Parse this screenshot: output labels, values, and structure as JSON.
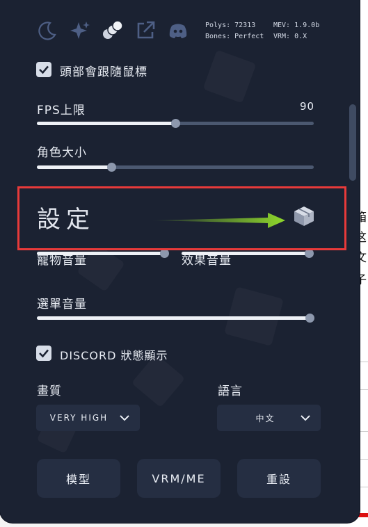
{
  "background_page": {
    "chars": [
      "箱",
      "这",
      "文",
      "子"
    ]
  },
  "toolbar": {
    "icons": [
      "moon-icon",
      "sparkles-icon",
      "coins-icon",
      "external-link-icon",
      "discord-icon"
    ]
  },
  "stats": {
    "polys": "Polys: 72313",
    "bones": "Bones: Perfect",
    "mev": "MEV: 1.9.0b",
    "vrm": "VRM: 0.X"
  },
  "head_follow": {
    "label": "頭部會跟隨鼠標",
    "checked": true
  },
  "fps": {
    "label": "FPS上限",
    "value": "90",
    "level": 0.5
  },
  "size": {
    "label": "角色大小",
    "level": 0.27
  },
  "settings": {
    "title": "設定",
    "icon": "box-icon"
  },
  "pet_volume": {
    "label": "寵物音量",
    "level": 1.0
  },
  "effect_volume": {
    "label": "效果音量",
    "level": 1.0
  },
  "menu_volume": {
    "label": "選單音量",
    "level": 1.0
  },
  "discord_status": {
    "label": "DISCORD 狀態顯示",
    "checked": true
  },
  "quality": {
    "label": "畫質",
    "value": "VERY HIGH"
  },
  "language": {
    "label": "語言",
    "value": "中文"
  },
  "buttons": {
    "model": "模型",
    "vrm_me": "VRM/ME",
    "reset": "重設"
  },
  "colors": {
    "panel": "#1b2232",
    "accent_red": "#e83a3a",
    "arrow_green": "#8fd82c"
  }
}
